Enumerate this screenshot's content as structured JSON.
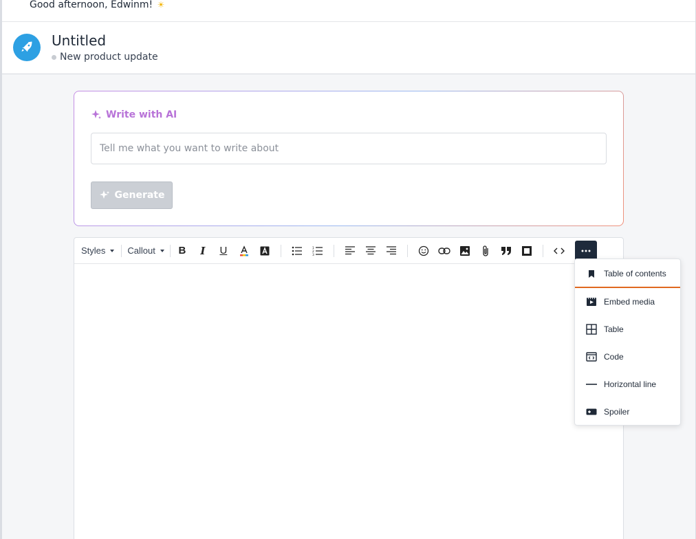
{
  "greeting": {
    "text": "Good afternoon, Edwinm!",
    "emoji": "☀"
  },
  "header": {
    "title": "Untitled",
    "subtitle": "New product update"
  },
  "ai": {
    "title": "Write with AI",
    "input_placeholder": "Tell me what you want to write about",
    "input_value": "",
    "generate_label": "Generate",
    "generate_enabled": false
  },
  "toolbar": {
    "styles_label": "Styles",
    "callout_label": "Callout",
    "buttons": [
      "bold-icon",
      "italic-icon",
      "underline-icon",
      "text-color-icon",
      "highlight-icon",
      "bullet-list-icon",
      "numbered-list-icon",
      "align-left-icon",
      "align-center-icon",
      "align-right-icon",
      "emoji-icon",
      "link-icon",
      "image-icon",
      "attachment-icon",
      "quote-icon",
      "box-icon",
      "code-inline-icon",
      "more-icon"
    ]
  },
  "menu": {
    "items": [
      {
        "label": "Table of contents",
        "icon": "bookmark-icon"
      },
      {
        "label": "Embed media",
        "icon": "film-icon"
      },
      {
        "label": "Table",
        "icon": "table-icon"
      },
      {
        "label": "Code",
        "icon": "code-block-icon"
      },
      {
        "label": "Horizontal line",
        "icon": "horizontal-line-icon"
      },
      {
        "label": "Spoiler",
        "icon": "spoiler-icon"
      }
    ]
  },
  "colors": {
    "accent_ai": "#b873d8",
    "avatar": "#2da0e3",
    "active_underline": "#e0681f",
    "toolbar_more_bg": "#1e2a3b"
  }
}
